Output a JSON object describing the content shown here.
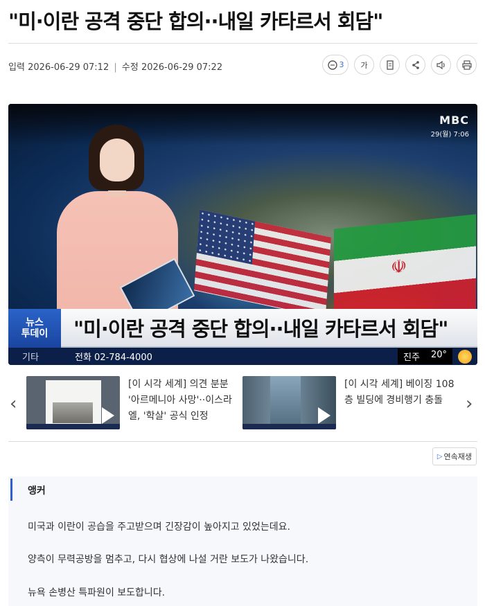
{
  "article": {
    "headline": "\"미·이란 공격 중단 합의··내일 카타르서 회담\"",
    "meta": {
      "input_label": "입력",
      "input_time": "2026-06-29 07:12",
      "sep": "|",
      "edit_label": "수정",
      "edit_time": "2026-06-29 07:22"
    },
    "tools": {
      "comment_count": "3",
      "font_label": "가",
      "icons": [
        "comment-icon",
        "font-size-icon",
        "bookmark-icon",
        "share-icon",
        "speaker-icon",
        "print-icon"
      ]
    }
  },
  "video": {
    "logo": "MBC",
    "broadcast_time": "29(월) 7:06",
    "show_badge_line1": "뉴스",
    "show_badge_line2": "투데이",
    "caption": "\"미·이란 공격 중단 합의··내일 카타르서 회담\"",
    "ticker_category": "기타",
    "ticker_phone": "전화 02-784-4000",
    "weather_city": "진주",
    "weather_temp": "20°"
  },
  "related": [
    {
      "title": "[이 시각 세계] 의견 분분 '아르메니아 사망'··이스라엘, '학살' 공식 인정"
    },
    {
      "title": "[이 시각 세계] 베이징 108층 빌딩에 경비행기 충돌"
    }
  ],
  "nav": {
    "prev": "‹",
    "next": "›"
  },
  "autoplay": {
    "label": "연속재생"
  },
  "script": {
    "speaker": "앵커",
    "lines": [
      "미국과 이란이 공습을 주고받으며 긴장감이 높아지고 있었는데요.",
      "양측이 무력공방을 멈추고, 다시 협상에 나설 거란 보도가 나왔습니다.",
      "뉴욕 손병산 특파원이 보도합니다."
    ]
  },
  "colors": {
    "accent_blue": "#2f5fd0",
    "badge_blue": "#2b63c8",
    "ticker_navy": "#0c1f48"
  }
}
